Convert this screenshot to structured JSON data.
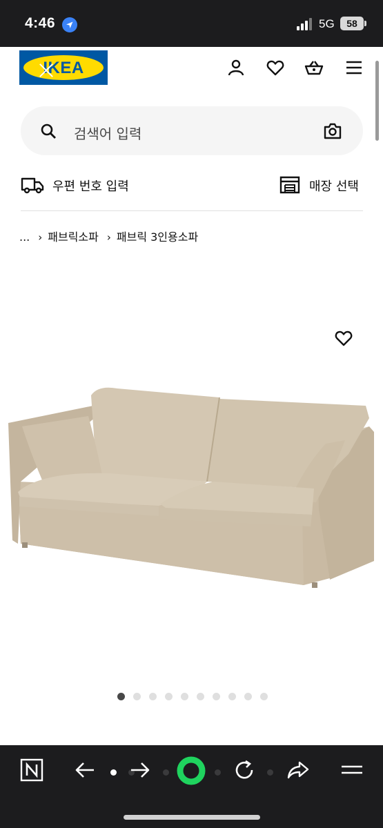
{
  "status_bar": {
    "time": "4:46",
    "network": "5G",
    "battery": "58"
  },
  "header": {
    "logo_text": "IKEA",
    "icons": [
      "account-icon",
      "heart-icon",
      "basket-icon",
      "menu-icon"
    ]
  },
  "search": {
    "placeholder": "검색어 입력"
  },
  "delivery": {
    "postcode_label": "우편 번호 입력",
    "store_label": "매장 선택"
  },
  "breadcrumb": {
    "ellipsis": "...",
    "separator": "›",
    "items": [
      "패브릭소파",
      "패브릭 3인용소파"
    ]
  },
  "gallery": {
    "total_images": 10,
    "current_index": 1
  },
  "browser_toolbar": {
    "icons": [
      "notion-icon",
      "back-arrow-icon",
      "forward-arrow-icon",
      "home-ring-icon",
      "reload-icon",
      "share-icon",
      "menu-icon"
    ],
    "accent_color": "#1fd35e"
  },
  "colors": {
    "ikea_blue": "#0058a3",
    "ikea_yellow": "#ffdb00",
    "sofa_beige": "#cdbfa9"
  }
}
